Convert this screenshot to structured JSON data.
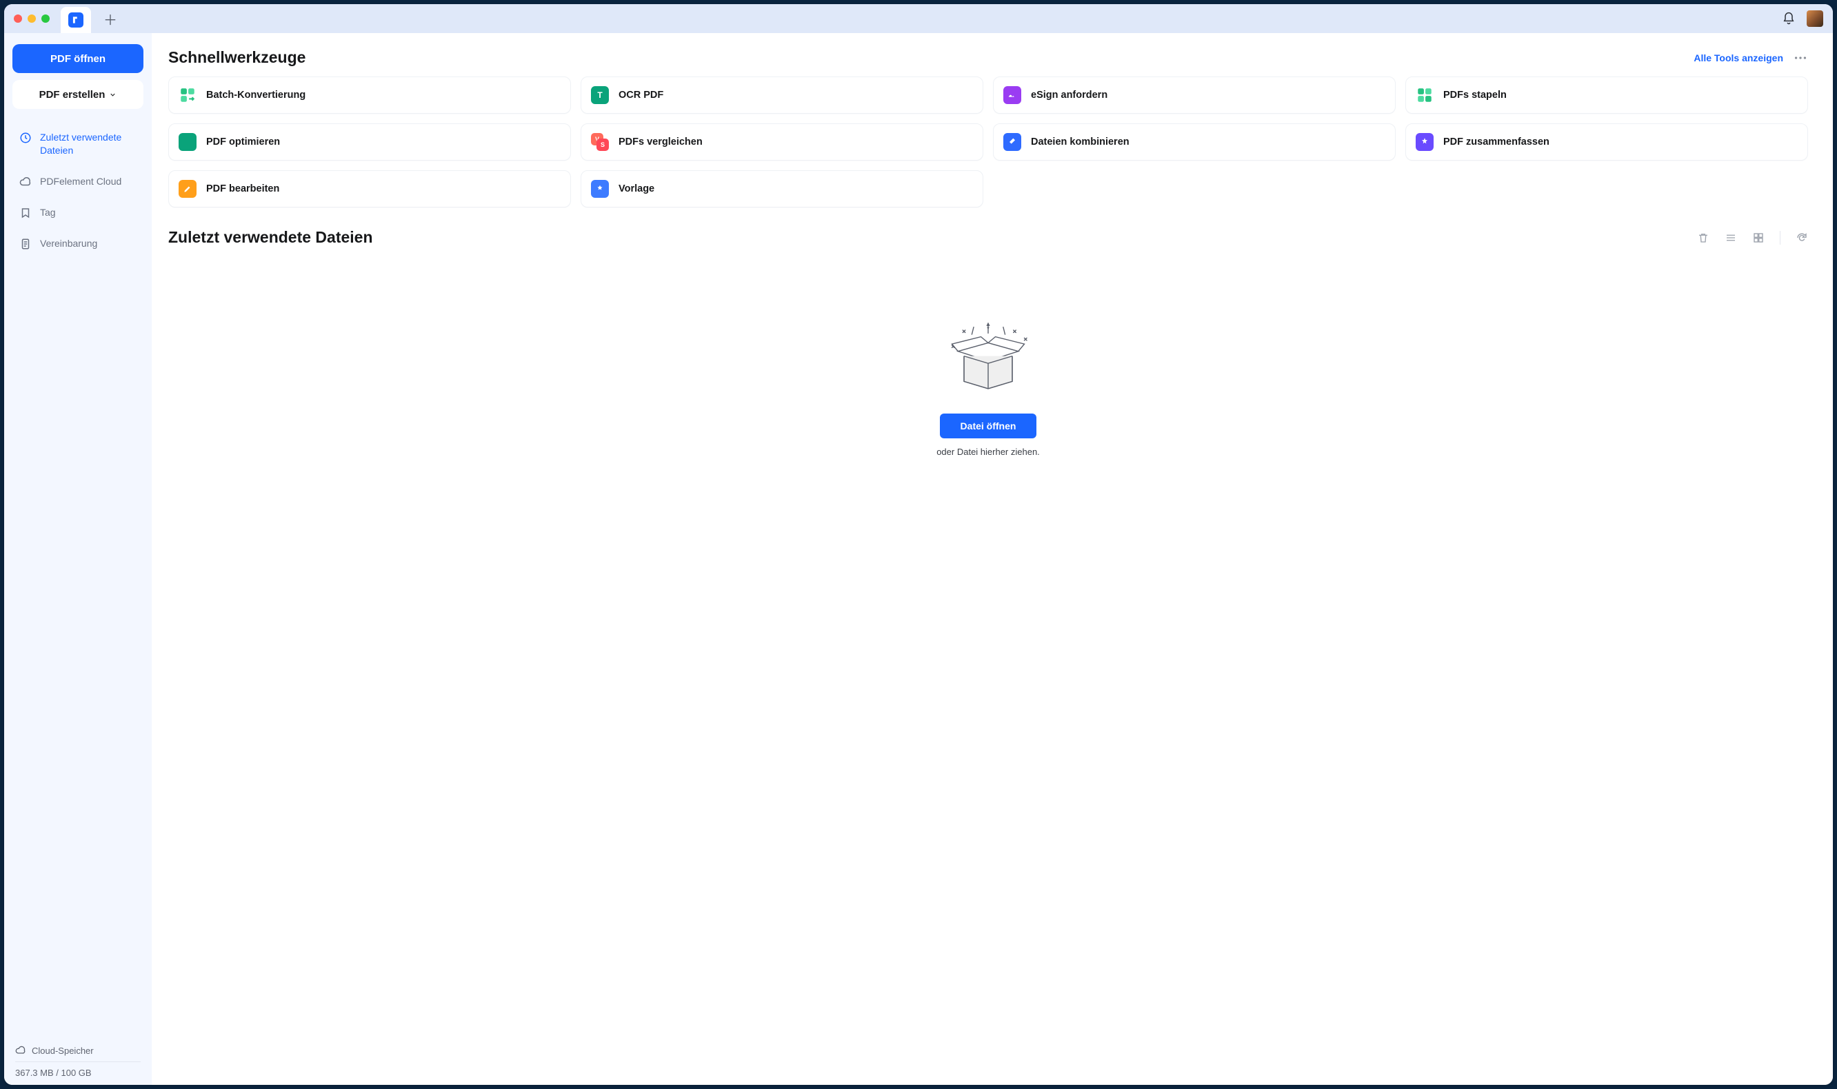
{
  "sidebar": {
    "open_pdf": "PDF öffnen",
    "create_pdf": "PDF erstellen",
    "nav": {
      "recent": "Zuletzt verwendete Dateien",
      "cloud": "PDFelement Cloud",
      "tag": "Tag",
      "agreement": "Vereinbarung"
    },
    "storage_title": "Cloud-Speicher",
    "storage_amount": "367.3 MB / 100 GB"
  },
  "header": {
    "quick_tools_title": "Schnellwerkzeuge",
    "show_all_tools": "Alle Tools anzeigen"
  },
  "tools": {
    "batch": "Batch-Konvertierung",
    "ocr": "OCR PDF",
    "esign": "eSign anfordern",
    "stack": "PDFs stapeln",
    "optimize": "PDF optimieren",
    "compare": "PDFs vergleichen",
    "combine": "Dateien kombinieren",
    "summarize": "PDF zusammenfassen",
    "edit": "PDF bearbeiten",
    "template": "Vorlage"
  },
  "recent_section": {
    "title": "Zuletzt verwendete Dateien",
    "open_file": "Datei öffnen",
    "drag_hint": "oder Datei hierher ziehen."
  }
}
